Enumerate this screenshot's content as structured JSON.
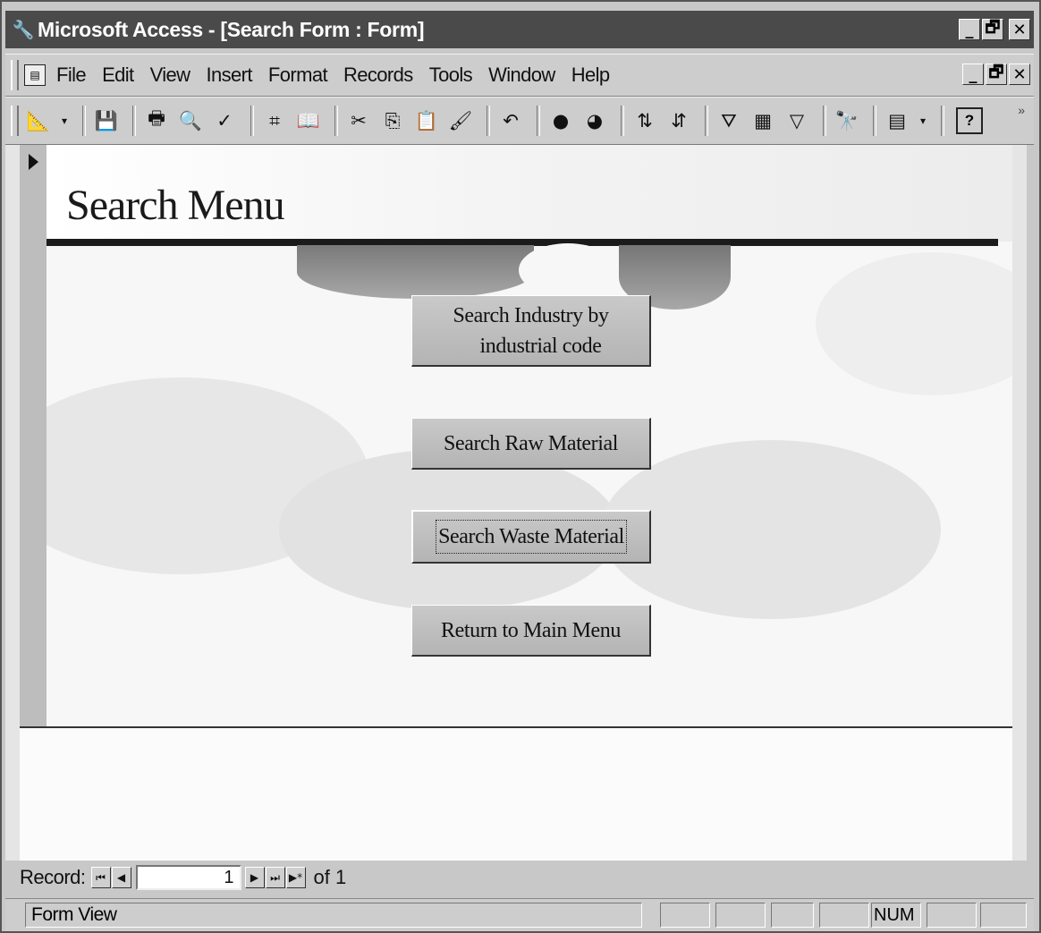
{
  "window": {
    "title": "Microsoft Access - [Search Form : Form]",
    "app_icon": "access-key-icon",
    "controls": [
      "_",
      "🗗",
      "✕"
    ]
  },
  "menubar": {
    "items": [
      {
        "label": "File"
      },
      {
        "label": "Edit"
      },
      {
        "label": "View"
      },
      {
        "label": "Insert"
      },
      {
        "label": "Format"
      },
      {
        "label": "Records"
      },
      {
        "label": "Tools"
      },
      {
        "label": "Window"
      },
      {
        "label": "Help"
      }
    ]
  },
  "toolbar": {
    "icons": [
      "view-icon",
      "save-icon",
      "print-icon",
      "print-preview-icon",
      "spelling-icon",
      "insert-hyperlink-icon",
      "web-toolbar-icon",
      "cut-icon",
      "copy-icon",
      "paste-icon",
      "format-painter-icon",
      "undo-icon",
      "office-links-icon",
      "analyze-icon",
      "sort-ascending-icon",
      "sort-descending-icon",
      "filter-by-selection-icon",
      "filter-by-form-icon",
      "apply-filter-icon",
      "find-icon",
      "new-object-icon",
      "help-icon"
    ]
  },
  "form": {
    "title": "Search Menu",
    "buttons": [
      {
        "label": "Search Industry by industrial code",
        "line1": "Search Industry by",
        "line2": "industrial code"
      },
      {
        "label": "Search Raw Material"
      },
      {
        "label": "Search Waste Material",
        "focused": true
      },
      {
        "label": "Return to Main Menu"
      }
    ]
  },
  "record_nav": {
    "label": "Record:",
    "current": "1",
    "of_text": "of 1"
  },
  "statusbar": {
    "text": "Form View",
    "num_indicator": "NUM"
  }
}
